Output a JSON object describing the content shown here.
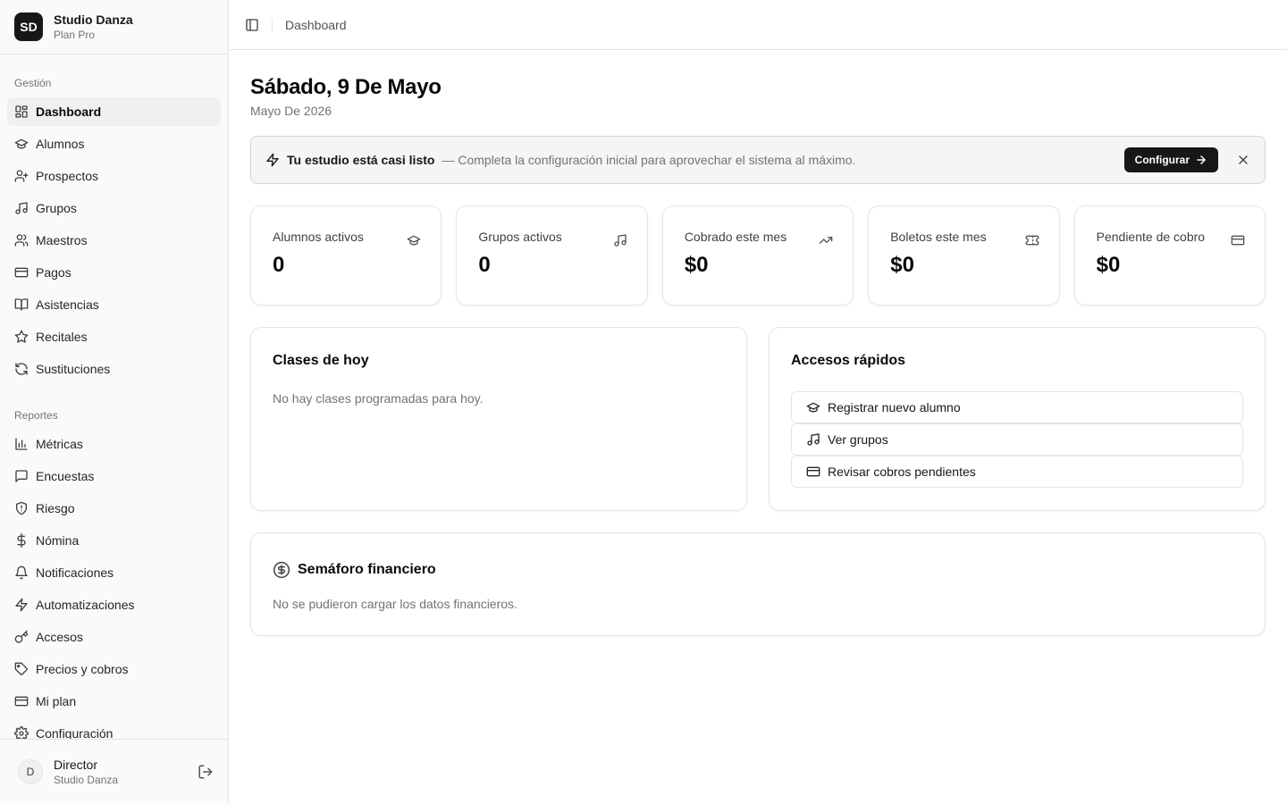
{
  "brand": {
    "initials": "SD",
    "name": "Studio Danza",
    "plan": "Plan Pro"
  },
  "sidebar": {
    "groups": [
      {
        "label": "Gestión",
        "items": [
          {
            "label": "Dashboard",
            "icon": "dashboard-icon",
            "active": true
          },
          {
            "label": "Alumnos",
            "icon": "graduation-cap-icon"
          },
          {
            "label": "Prospectos",
            "icon": "user-plus-icon"
          },
          {
            "label": "Grupos",
            "icon": "music-icon"
          },
          {
            "label": "Maestros",
            "icon": "users-icon"
          },
          {
            "label": "Pagos",
            "icon": "credit-card-icon"
          },
          {
            "label": "Asistencias",
            "icon": "book-open-icon"
          },
          {
            "label": "Recitales",
            "icon": "star-icon"
          },
          {
            "label": "Sustituciones",
            "icon": "refresh-icon"
          }
        ]
      },
      {
        "label": "Reportes",
        "items": [
          {
            "label": "Métricas",
            "icon": "bar-chart-icon"
          },
          {
            "label": "Encuestas",
            "icon": "message-square-icon"
          },
          {
            "label": "Riesgo",
            "icon": "shield-icon"
          },
          {
            "label": "Nómina",
            "icon": "dollar-icon"
          },
          {
            "label": "Notificaciones",
            "icon": "bell-icon"
          },
          {
            "label": "Automatizaciones",
            "icon": "zap-icon"
          },
          {
            "label": "Accesos",
            "icon": "key-icon"
          },
          {
            "label": "Precios y cobros",
            "icon": "tag-icon"
          },
          {
            "label": "Mi plan",
            "icon": "credit-card-icon"
          },
          {
            "label": "Configuración",
            "icon": "gear-icon"
          }
        ]
      }
    ]
  },
  "user": {
    "initial": "D",
    "name": "Director",
    "org": "Studio Danza"
  },
  "header": {
    "breadcrumb": "Dashboard"
  },
  "page": {
    "title": "Sábado, 9 De Mayo",
    "subtitle": "Mayo De 2026"
  },
  "banner": {
    "title": "Tu estudio está casi listo",
    "text": "— Completa la configuración inicial para aprovechar el sistema al máximo.",
    "button": "Configurar"
  },
  "stats": [
    {
      "label": "Alumnos activos",
      "value": "0",
      "icon": "graduation-cap-icon"
    },
    {
      "label": "Grupos activos",
      "value": "0",
      "icon": "music-icon"
    },
    {
      "label": "Cobrado este mes",
      "value": "$0",
      "icon": "trending-up-icon"
    },
    {
      "label": "Boletos este mes",
      "value": "$0",
      "icon": "ticket-icon"
    },
    {
      "label": "Pendiente de cobro",
      "value": "$0",
      "icon": "credit-card-icon"
    }
  ],
  "today": {
    "title": "Clases de hoy",
    "empty": "No hay clases programadas para hoy."
  },
  "quick": {
    "title": "Accesos rápidos",
    "items": [
      {
        "label": "Registrar nuevo alumno",
        "icon": "graduation-cap-icon"
      },
      {
        "label": "Ver grupos",
        "icon": "music-icon"
      },
      {
        "label": "Revisar cobros pendientes",
        "icon": "credit-card-icon"
      }
    ]
  },
  "finance": {
    "title": "Semáforo financiero",
    "empty": "No se pudieron cargar los datos financieros."
  },
  "colors": {
    "primary": "#171717",
    "sidebar_bg": "#fafafa",
    "border": "#e5e5e5",
    "muted": "#737373",
    "banner_bg": "#f5f5f5"
  }
}
